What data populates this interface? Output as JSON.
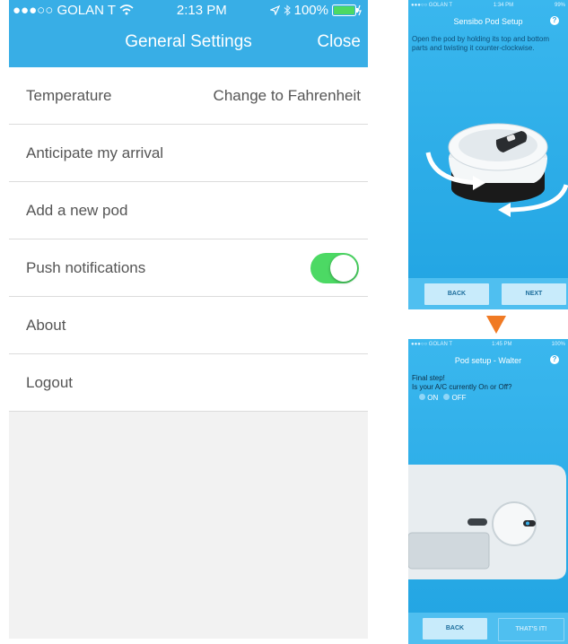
{
  "settings": {
    "status_bar": {
      "carrier": "●●●○○ GOLAN T",
      "time": "2:13 PM",
      "battery": "100%"
    },
    "title": "General Settings",
    "close_label": "Close",
    "rows": [
      {
        "label": "Temperature",
        "value": "Change to Fahrenheit"
      },
      {
        "label": "Anticipate my arrival"
      },
      {
        "label": "Add a new pod"
      },
      {
        "label": "Push notifications",
        "toggle_on": true
      },
      {
        "label": "About"
      },
      {
        "label": "Logout"
      }
    ],
    "accent_color": "#38aee6",
    "toggle_color": "#4cd964"
  },
  "pod_setup": {
    "status_bar": {
      "carrier": "●●●○○ GOLAN T",
      "time": "1:34 PM",
      "battery": "99%"
    },
    "title": "Sensibo Pod Setup",
    "help_icon": "?",
    "instruction": "Open the pod by holding its top and bottom parts and twisting it counter-clockwise.",
    "back_label": "BACK",
    "next_label": "NEXT"
  },
  "pod_setup_walter": {
    "status_bar": {
      "carrier": "●●●○○ GOLAN T",
      "time": "1:45 PM",
      "battery": "100%"
    },
    "title": "Pod setup - Walter",
    "help_icon": "?",
    "final_step": "Final step!",
    "question": "Is your A/C currently On or Off?",
    "option_on": "ON",
    "option_off": "OFF",
    "back_label": "BACK",
    "done_label": "THAT'S IT!"
  },
  "arrow_color": "#f07a24"
}
